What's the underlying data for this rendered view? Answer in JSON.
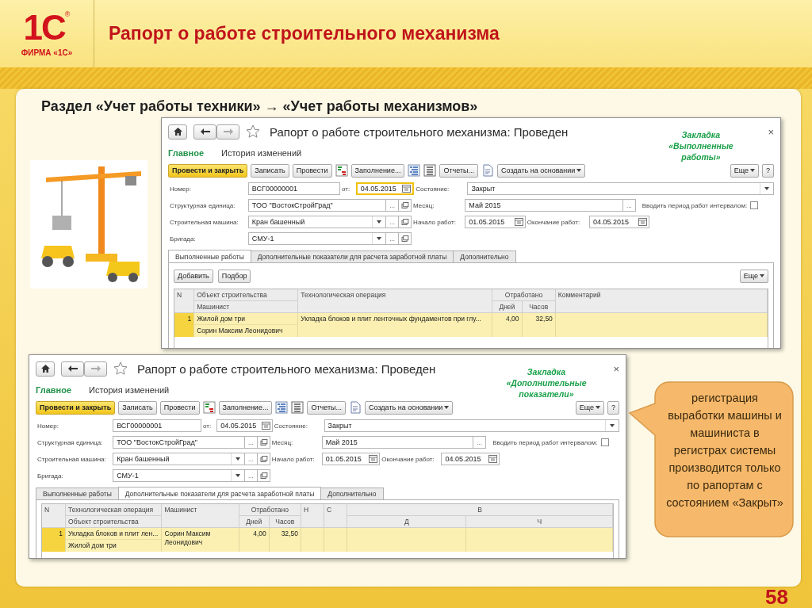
{
  "header": {
    "logo_mark": "1С",
    "logo_registered": "®",
    "logo_caption": "ФИРМА «1С»",
    "title": "Рапорт о работе строительного механизма"
  },
  "subtitle": "Раздел «Учет работы техники» → «Учет работы механизмов»",
  "windows": [
    {
      "title": "Рапорт о работе строительного механизма: Проведен",
      "close": "×",
      "note": "Закладка «Выполненные работы»",
      "sections": [
        {
          "label": "Главное",
          "selected": true
        },
        {
          "label": "История изменений",
          "selected": false
        }
      ],
      "toolbar": [
        {
          "kind": "primary",
          "label": "Провести и закрыть"
        },
        {
          "kind": "button",
          "label": "Записать"
        },
        {
          "kind": "button",
          "label": "Провести"
        },
        {
          "kind": "icon"
        },
        {
          "kind": "button",
          "label": "Заполнение..."
        },
        {
          "kind": "icon"
        },
        {
          "kind": "icon"
        },
        {
          "kind": "button",
          "label": "Отчеты..."
        },
        {
          "kind": "icon"
        },
        {
          "kind": "menu",
          "label": "Создать на основании"
        }
      ],
      "toolbar_right": [
        {
          "kind": "menu",
          "label": "Еще"
        },
        {
          "kind": "button",
          "label": "?"
        }
      ],
      "form": [
        [
          {
            "kind": "label",
            "text": "Номер:"
          },
          {
            "kind": "input",
            "value": "ВСГ00000001"
          },
          {
            "kind": "label",
            "text": "от:"
          },
          {
            "kind": "date",
            "value": "04.05.2015",
            "focused": true
          },
          {
            "kind": "label",
            "text": "Состояние:"
          },
          {
            "kind": "input",
            "value": "Закрыт",
            "choice": true
          }
        ],
        [
          {
            "kind": "label",
            "text": "Структурная единица:"
          },
          {
            "kind": "input",
            "value": "ТОО \"ВостокСтройГрад\"",
            "more": "...",
            "open": true
          },
          {
            "kind": "label",
            "text": "Месяц:"
          },
          {
            "kind": "input",
            "value": "Май 2015",
            "more": "..."
          },
          {
            "kind": "checkbox",
            "label": "Вводить период работ интервалом:",
            "checked": false
          }
        ],
        [
          {
            "kind": "label",
            "text": "Строительная машина:"
          },
          {
            "kind": "input",
            "value": "Кран башенный",
            "choice": true,
            "more": "...",
            "open": true
          },
          {
            "kind": "label",
            "text": "Начало работ:"
          },
          {
            "kind": "date",
            "value": "01.05.2015",
            "focused": false
          },
          {
            "kind": "label",
            "text": "Окончание работ:"
          },
          {
            "kind": "date",
            "value": "04.05.2015",
            "focused": false
          }
        ],
        [
          {
            "kind": "label",
            "text": "Бригада:"
          },
          {
            "kind": "input",
            "value": "СМУ-1",
            "choice": true,
            "more": "...",
            "open": true
          }
        ]
      ],
      "tabs": [
        {
          "label": "Выполненные работы",
          "selected": true
        },
        {
          "label": "Дополнительные показатели для расчета заработной платы",
          "selected": false
        },
        {
          "label": "Дополнительно",
          "selected": false
        }
      ],
      "commands": [
        {
          "kind": "button",
          "label": "Добавить"
        },
        {
          "kind": "button",
          "label": "Подбор"
        }
      ],
      "commands_right": [
        {
          "kind": "menu",
          "label": "Еще"
        }
      ],
      "table": {
        "columns": [
          {
            "title": "N"
          },
          {
            "title": "Объект строительства",
            "sub": "Машинист"
          },
          {
            "title": "Технологическая операция"
          },
          {
            "title": "Отработано",
            "children": [
              "Дней",
              "Часов"
            ]
          },
          {
            "title": "Комментарий"
          }
        ],
        "rows": [
          {
            "selected": true,
            "cells": [
              {
                "text": "1"
              },
              {
                "top": "Жилой дом три",
                "bottom": "Сорин Максим Леонидович"
              },
              {
                "text": "Укладка блоков и плит ленточных фундаментов при глу..."
              },
              {
                "parts": [
                  "4,00",
                  "32,50"
                ]
              }
            ]
          }
        ]
      }
    },
    {
      "title": "Рапорт о работе строительного механизма: Проведен",
      "close": "×",
      "note": "Закладка «Дополнительные показатели»",
      "sections": [
        {
          "label": "Главное",
          "selected": true
        },
        {
          "label": "История изменений",
          "selected": false
        }
      ],
      "toolbar": [
        {
          "kind": "primary",
          "label": "Провести и закрыть"
        },
        {
          "kind": "button",
          "label": "Записать"
        },
        {
          "kind": "button",
          "label": "Провести"
        },
        {
          "kind": "icon"
        },
        {
          "kind": "button",
          "label": "Заполнение..."
        },
        {
          "kind": "icon"
        },
        {
          "kind": "icon"
        },
        {
          "kind": "button",
          "label": "Отчеты..."
        },
        {
          "kind": "icon"
        },
        {
          "kind": "menu",
          "label": "Создать на основании"
        }
      ],
      "toolbar_right": [
        {
          "kind": "menu",
          "label": "Еще"
        },
        {
          "kind": "button",
          "label": "?"
        }
      ],
      "form": [
        [
          {
            "kind": "label",
            "text": "Номер:"
          },
          {
            "kind": "input",
            "value": "ВСГ00000001"
          },
          {
            "kind": "label",
            "text": "от:"
          },
          {
            "kind": "date",
            "value": "04.05.2015",
            "focused": false
          },
          {
            "kind": "label",
            "text": "Состояние:"
          },
          {
            "kind": "input",
            "value": "Закрыт",
            "choice": true
          }
        ],
        [
          {
            "kind": "label",
            "text": "Структурная единица:"
          },
          {
            "kind": "input",
            "value": "ТОО \"ВостокСтройГрад\"",
            "more": "...",
            "open": true
          },
          {
            "kind": "label",
            "text": "Месяц:"
          },
          {
            "kind": "input",
            "value": "Май 2015",
            "more": "..."
          },
          {
            "kind": "checkbox",
            "label": "Вводить период работ интервалом:",
            "checked": false
          }
        ],
        [
          {
            "kind": "label",
            "text": "Строительная машина:"
          },
          {
            "kind": "input",
            "value": "Кран башенный",
            "choice": true,
            "more": "...",
            "open": true
          },
          {
            "kind": "label",
            "text": "Начало работ:"
          },
          {
            "kind": "date",
            "value": "01.05.2015",
            "focused": false
          },
          {
            "kind": "label",
            "text": "Окончание работ:"
          },
          {
            "kind": "date",
            "value": "04.05.2015",
            "focused": false
          }
        ],
        [
          {
            "kind": "label",
            "text": "Бригада:"
          },
          {
            "kind": "input",
            "value": "СМУ-1",
            "choice": true,
            "more": "...",
            "open": true
          }
        ]
      ],
      "tabs": [
        {
          "label": "Выполненные работы",
          "selected": false
        },
        {
          "label": "Дополнительные показатели для расчета заработной платы",
          "selected": true
        },
        {
          "label": "Дополнительно",
          "selected": false
        }
      ],
      "table": {
        "columns": [
          {
            "title": "N"
          },
          {
            "title": "Технологическая операция",
            "sub": "Объект строительства"
          },
          {
            "title": "Машинист"
          },
          {
            "title": "Отработано",
            "children": [
              "Дней",
              "Часов"
            ]
          },
          {
            "title": "Н"
          },
          {
            "title": "С"
          },
          {
            "title": "В",
            "children": [
              "Д",
              "Ч"
            ]
          }
        ],
        "rows": [
          {
            "selected": true,
            "cells": [
              {
                "text": "1"
              },
              {
                "top": "Укладка блоков и плит лен...",
                "bottom": "Жилой дом три"
              },
              {
                "text": "Сорин Максим Леонидович"
              },
              {
                "parts": [
                  "4,00",
                  "32,50"
                ]
              }
            ]
          }
        ]
      }
    }
  ],
  "callout": "регистрация выработки машины и машиниста в регистрах системы производится только по рапортам с состоянием «Закрыт»",
  "page_number": "58"
}
